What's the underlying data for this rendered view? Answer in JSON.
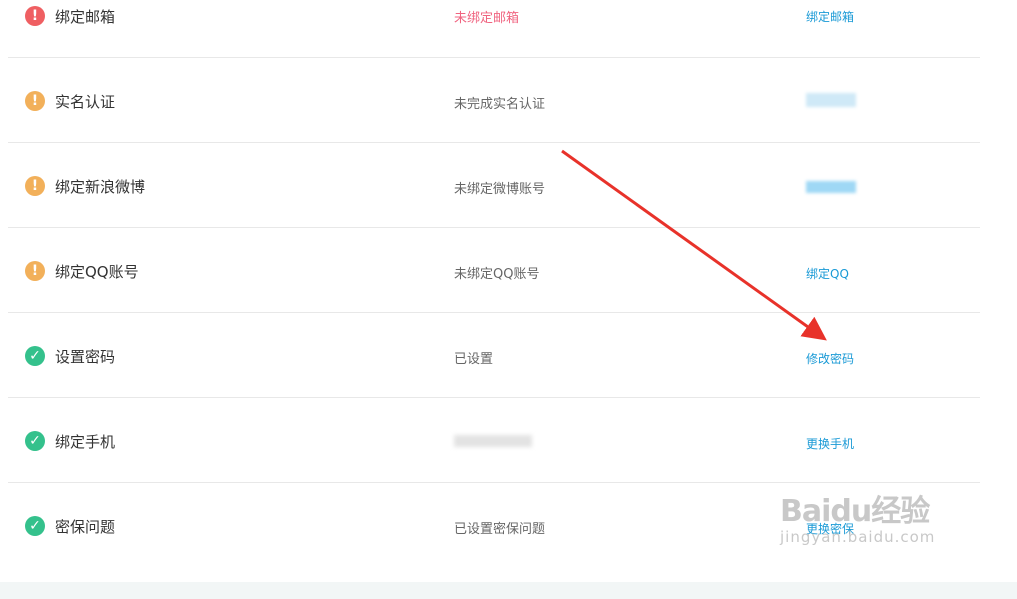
{
  "rows": [
    {
      "icon": "warning-icon",
      "icon_glyph": "!",
      "color": "red",
      "name": "绑定邮箱",
      "status": "未绑定邮箱",
      "status_style": "warn",
      "action": "绑定邮箱"
    },
    {
      "icon": "warning-icon",
      "icon_glyph": "!",
      "color": "orange",
      "name": "实名认证",
      "status": "未完成实名认证",
      "action": ""
    },
    {
      "icon": "warning-icon",
      "icon_glyph": "!",
      "color": "orange",
      "name": "绑定新浪微博",
      "status": "未绑定微博账号",
      "action": ""
    },
    {
      "icon": "warning-icon",
      "icon_glyph": "!",
      "color": "orange",
      "name": "绑定QQ账号",
      "status": "未绑定QQ账号",
      "action": "绑定QQ"
    },
    {
      "icon": "check-icon",
      "icon_glyph": "✓",
      "color": "green",
      "name": "设置密码",
      "status": "已设置",
      "action": "修改密码"
    },
    {
      "icon": "check-icon",
      "icon_glyph": "✓",
      "color": "green",
      "name": "绑定手机",
      "status": "",
      "action": "更换手机"
    },
    {
      "icon": "check-icon",
      "icon_glyph": "✓",
      "color": "green",
      "name": "密保问题",
      "status": "已设置密保问题",
      "action": "更换密保"
    }
  ],
  "watermark": {
    "logo": "Baidu经验",
    "url": "jingyan.baidu.com"
  },
  "colors": {
    "warn_red": "#ef5f62",
    "warn_orange": "#f2b05a",
    "ok_green": "#34c18c",
    "link_blue": "#1a9ad6",
    "arrow_red": "#e8322a"
  }
}
